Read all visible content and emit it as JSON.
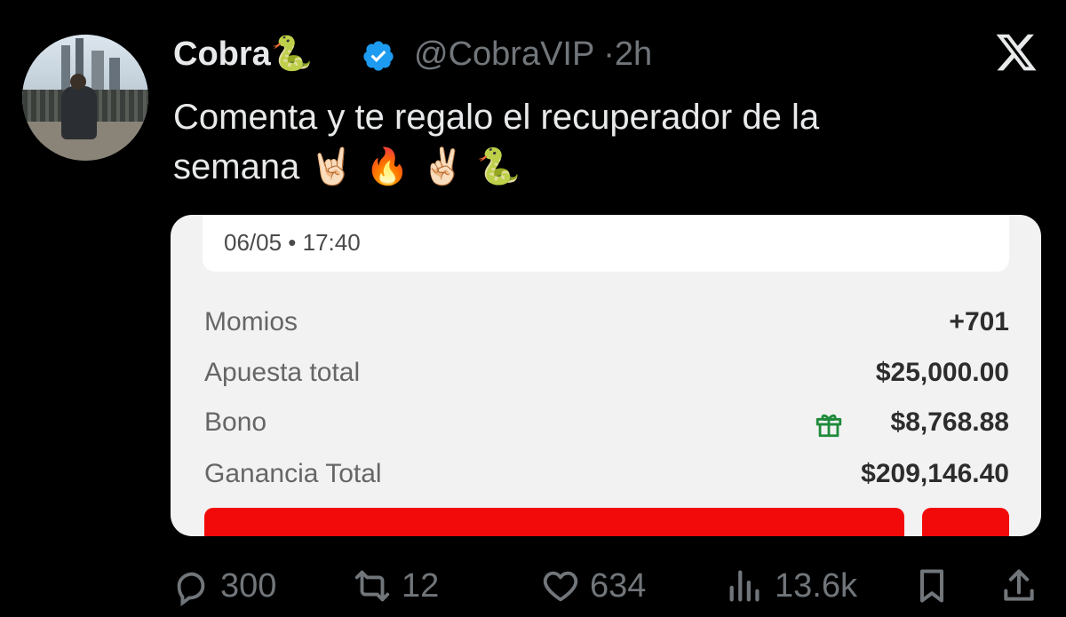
{
  "author": {
    "name": "Cobra",
    "name_emoji": "🐍",
    "handle": "@CobraVIP",
    "separator": "·",
    "time": "2h",
    "verified": true
  },
  "tweet": {
    "text_line1": "Comenta y te regalo el recuperador de la",
    "text_line2": "semana",
    "emojis": "🤘🏻 🔥 ✌🏻 🐍"
  },
  "card": {
    "date_time": "06/05 • 17:40",
    "rows": [
      {
        "label": "Momios",
        "value": "+701"
      },
      {
        "label": "Apuesta total",
        "value": "$25,000.00"
      },
      {
        "label": "Bono",
        "value": "$8,768.88",
        "icon": "gift-icon"
      },
      {
        "label": "Ganancia Total",
        "value": "$209,146.40"
      }
    ],
    "accent_color": "#f20a0a"
  },
  "actions": {
    "replies": "300",
    "reposts": "12",
    "likes": "634",
    "views": "13.6k"
  },
  "colors": {
    "background": "#000000",
    "text": "#e7e9ea",
    "muted": "#71767b",
    "verified": "#1d9bf0"
  }
}
